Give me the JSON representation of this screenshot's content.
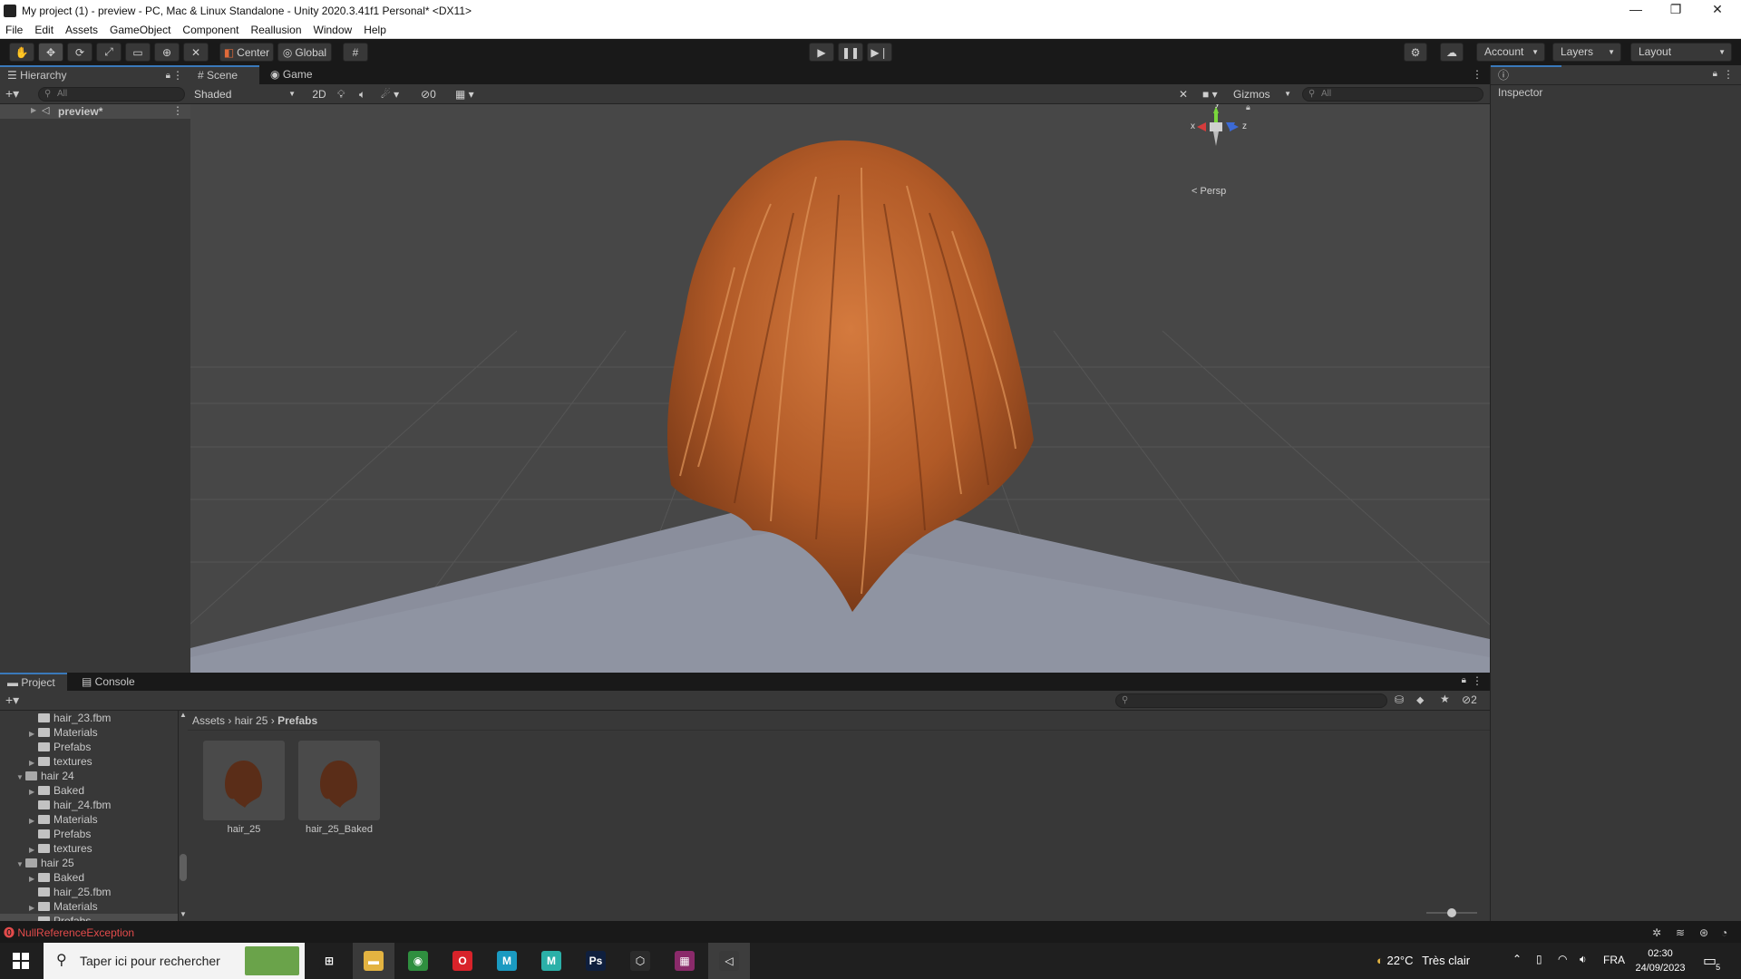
{
  "window": {
    "title": "My project (1) - preview - PC, Mac & Linux Standalone - Unity 2020.3.41f1 Personal* <DX11>",
    "controls": [
      "—",
      "❐",
      "✕"
    ]
  },
  "menubar": [
    "File",
    "Edit",
    "Assets",
    "GameObject",
    "Component",
    "Reallusion",
    "Window",
    "Help"
  ],
  "toolbar": {
    "pivot_label": "Center",
    "space_label": "Global",
    "account_label": "Account",
    "layers_label": "Layers",
    "layout_label": "Layout"
  },
  "hierarchy": {
    "tab_label": "Hierarchy",
    "search_placeholder": "All",
    "scene_item": "preview*"
  },
  "scene": {
    "tab_scene": "Scene",
    "tab_game": "Game",
    "shading_mode": "Shaded",
    "mode_2d": "2D",
    "hidden_count": "0",
    "gizmos_label": "Gizmos",
    "search_placeholder": "All",
    "axis_x": "x",
    "axis_y": "y",
    "axis_z": "z",
    "projection": "Persp"
  },
  "inspector": {
    "tab_label": "Inspector"
  },
  "project": {
    "tab_project": "Project",
    "tab_console": "Console",
    "hidden_count": "2",
    "tree": [
      {
        "label": "hair_23.fbm",
        "indent": 2,
        "type": "folder",
        "arrow": ""
      },
      {
        "label": "Materials",
        "indent": 2,
        "type": "folder",
        "arrow": "▶"
      },
      {
        "label": "Prefabs",
        "indent": 2,
        "type": "folder",
        "arrow": ""
      },
      {
        "label": "textures",
        "indent": 2,
        "type": "folder",
        "arrow": "▶"
      },
      {
        "label": "hair 24",
        "indent": 1,
        "type": "folder-open",
        "arrow": "▼"
      },
      {
        "label": "Baked",
        "indent": 2,
        "type": "folder",
        "arrow": "▶"
      },
      {
        "label": "hair_24.fbm",
        "indent": 2,
        "type": "folder",
        "arrow": ""
      },
      {
        "label": "Materials",
        "indent": 2,
        "type": "folder",
        "arrow": "▶"
      },
      {
        "label": "Prefabs",
        "indent": 2,
        "type": "folder",
        "arrow": ""
      },
      {
        "label": "textures",
        "indent": 2,
        "type": "folder",
        "arrow": "▶"
      },
      {
        "label": "hair 25",
        "indent": 1,
        "type": "folder-open",
        "arrow": "▼"
      },
      {
        "label": "Baked",
        "indent": 2,
        "type": "folder",
        "arrow": "▶"
      },
      {
        "label": "hair_25.fbm",
        "indent": 2,
        "type": "folder",
        "arrow": ""
      },
      {
        "label": "Materials",
        "indent": 2,
        "type": "folder",
        "arrow": "▶"
      },
      {
        "label": "Prefabs",
        "indent": 2,
        "type": "folder",
        "arrow": "",
        "selected": true
      }
    ],
    "breadcrumb": [
      "Assets",
      "hair 25",
      "Prefabs"
    ],
    "assets": [
      {
        "name": "hair_25"
      },
      {
        "name": "hair_25_Baked"
      }
    ],
    "thumbnail_zoom": 0.5
  },
  "status": {
    "error_text": "NullReferenceException"
  },
  "taskbar": {
    "search_placeholder": "Taper ici pour rechercher",
    "weather_temp": "22°C",
    "weather_desc": "Très clair",
    "language": "FRA",
    "time": "02:30",
    "date": "24/09/2023",
    "notification_count": "5",
    "apps": [
      {
        "name": "task-view",
        "color": "#1f1f1f",
        "glyph": "⊞"
      },
      {
        "name": "file-explorer",
        "color": "#e3b341",
        "glyph": "▬"
      },
      {
        "name": "chrome",
        "color": "#2f8f3f",
        "glyph": "◉"
      },
      {
        "name": "opera",
        "color": "#d8232a",
        "glyph": "O"
      },
      {
        "name": "maya",
        "color": "#1a9ac1",
        "glyph": "M"
      },
      {
        "name": "maya-lt",
        "color": "#2bb0a8",
        "glyph": "M"
      },
      {
        "name": "photoshop",
        "color": "#0f1f3d",
        "glyph": "Ps"
      },
      {
        "name": "unity-hub",
        "color": "#2b2b2b",
        "glyph": "⬡"
      },
      {
        "name": "winrar",
        "color": "#8a2a6a",
        "glyph": "▦"
      },
      {
        "name": "unity-editor",
        "color": "#3a3a3a",
        "glyph": "◁"
      }
    ]
  },
  "colors": {
    "accent": "#3a79bb",
    "hair": "#b8612c",
    "error": "#e24b4b",
    "panel": "#383838",
    "viewport_bg": "#474747",
    "floor": "#8a8e9c"
  }
}
